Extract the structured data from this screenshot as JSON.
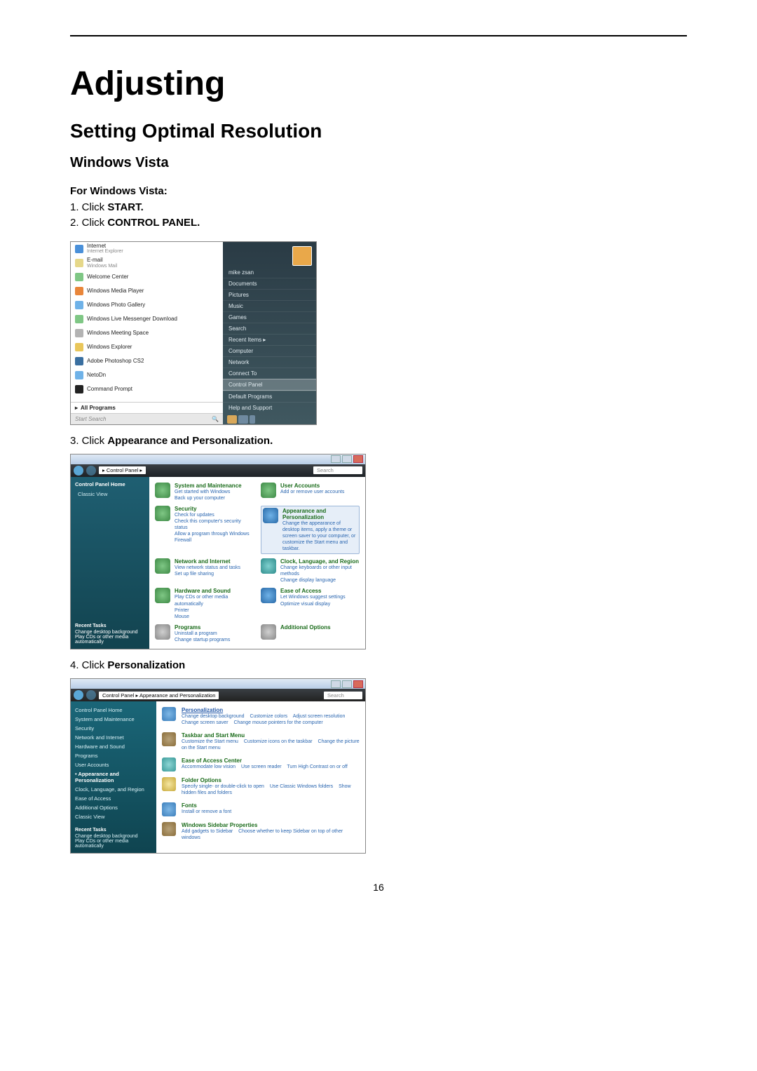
{
  "page": {
    "title": "Adjusting",
    "subtitle": "Setting Optimal Resolution",
    "section": "Windows Vista",
    "for_label": "For Windows Vista:",
    "step1_prefix": "1.    Click ",
    "step1_bold": "START.",
    "step2_prefix": "2.    Click ",
    "step2_bold": "CONTROL PANEL.",
    "step3_prefix": "3.    Click ",
    "step3_bold": "Appearance and Personalization.",
    "step4_prefix": "4.    Click ",
    "step4_bold": "Personalization",
    "page_number": "16"
  },
  "startmenu": {
    "left": {
      "internet_title": "Internet",
      "internet_sub": "Internet Explorer",
      "email_title": "E-mail",
      "email_sub": "Windows Mail",
      "items": [
        "Welcome Center",
        "Windows Media Player",
        "Windows Photo Gallery",
        "Windows Live Messenger Download",
        "Windows Meeting Space",
        "Windows Explorer",
        "Adobe Photoshop CS2",
        "NetoDn",
        "Command Prompt"
      ],
      "all_programs": "All Programs",
      "search_placeholder": "Start Search"
    },
    "right": {
      "user": "mike zsan",
      "items": [
        "Documents",
        "Pictures",
        "Music",
        "Games",
        "Search",
        "Recent Items",
        "Computer",
        "Network",
        "Connect To",
        "Control Panel",
        "Default Programs",
        "Help and Support"
      ],
      "highlight_index": 9
    }
  },
  "cp": {
    "breadcrumb": "Control Panel",
    "search_placeholder": "Search",
    "side": {
      "header": "Control Panel Home",
      "classic": "Classic View",
      "recent_title": "Recent Tasks",
      "recent1": "Change desktop background",
      "recent2": "Play CDs or other media automatically"
    },
    "cats": [
      {
        "title": "System and Maintenance",
        "links": "Get started with Windows\nBack up your computer",
        "ico": "gr"
      },
      {
        "title": "User Accounts",
        "links": "Add or remove user accounts",
        "ico": "gr"
      },
      {
        "title": "Security",
        "links": "Check for updates\nCheck this computer's security status\nAllow a program through Windows Firewall",
        "ico": "gr"
      },
      {
        "title": "Appearance and Personalization",
        "links": "Change the appearance of desktop items, apply a theme or screen saver to your computer, or customize the Start menu and taskbar.",
        "ico": "bl",
        "hl": true
      },
      {
        "title": "Network and Internet",
        "links": "View network status and tasks\nSet up file sharing",
        "ico": "gr"
      },
      {
        "title": "Clock, Language, and Region",
        "links": "Change keyboards or other input methods\nChange display language",
        "ico": "te"
      },
      {
        "title": "Hardware and Sound",
        "links": "Play CDs or other media automatically\nPrinter\nMouse",
        "ico": "gr"
      },
      {
        "title": "Ease of Access",
        "links": "Let Windows suggest settings\nOptimize visual display",
        "ico": "bl"
      },
      {
        "title": "Programs",
        "links": "Uninstall a program\nChange startup programs",
        "ico": "gy"
      },
      {
        "title": "Additional Options",
        "links": "",
        "ico": "gy"
      }
    ]
  },
  "ap": {
    "breadcrumb": "Control Panel ▸ Appearance and Personalization",
    "search_placeholder": "Search",
    "side": {
      "items": [
        "Control Panel Home",
        "System and Maintenance",
        "Security",
        "Network and Internet",
        "Hardware and Sound",
        "Programs",
        "User Accounts",
        "Appearance and Personalization",
        "Clock, Language, and Region",
        "Ease of Access",
        "Additional Options",
        "Classic View"
      ],
      "active_index": 7,
      "recent_title": "Recent Tasks",
      "recent1": "Change desktop background",
      "recent2": "Play CDs or other media automatically"
    },
    "rows": [
      {
        "title": "Personalization",
        "link": true,
        "ico": "bl",
        "links": [
          "Change desktop background",
          "Customize colors",
          "Adjust screen resolution",
          "Change screen saver",
          "Change mouse pointers for the computer"
        ]
      },
      {
        "title": "Taskbar and Start Menu",
        "ico": "gr",
        "links": [
          "Customize the Start menu",
          "Customize icons on the taskbar",
          "Change the picture on the Start menu"
        ]
      },
      {
        "title": "Ease of Access Center",
        "ico": "te",
        "links": [
          "Accommodate low vision",
          "Use screen reader",
          "Turn High Contrast on or off"
        ]
      },
      {
        "title": "Folder Options",
        "ico": "ye",
        "links": [
          "Specify single- or double-click to open",
          "Use Classic Windows folders",
          "Show hidden files and folders"
        ]
      },
      {
        "title": "Fonts",
        "ico": "bl",
        "links": [
          "Install or remove a font"
        ]
      },
      {
        "title": "Windows Sidebar Properties",
        "ico": "gr",
        "links": [
          "Add gadgets to Sidebar",
          "Choose whether to keep Sidebar on top of other windows"
        ]
      }
    ]
  }
}
